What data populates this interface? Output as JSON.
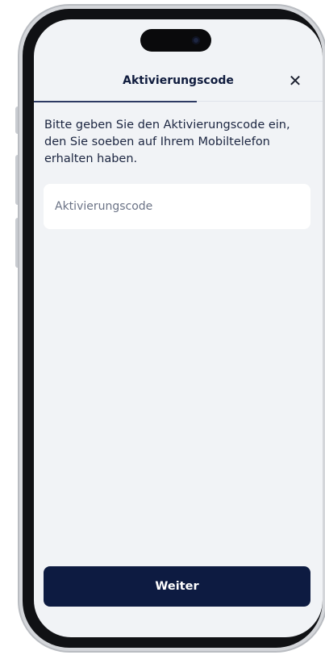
{
  "header": {
    "title": "Aktivierungscode",
    "close_icon": "close-icon",
    "close_glyph": "✕"
  },
  "content": {
    "instruction": "Bitte geben Sie den Aktivierungscode ein, den Sie soeben auf Ihrem Mobiltelefon erhalten haben.",
    "code_input": {
      "value": "",
      "placeholder": "Aktivierungscode"
    }
  },
  "footer": {
    "next_label": "Weiter"
  },
  "colors": {
    "screen_background": "#f1f3f6",
    "primary_button": "#0d1b41",
    "title_text": "#0f1b3d",
    "active_tab_indicator": "#2d3a63"
  }
}
